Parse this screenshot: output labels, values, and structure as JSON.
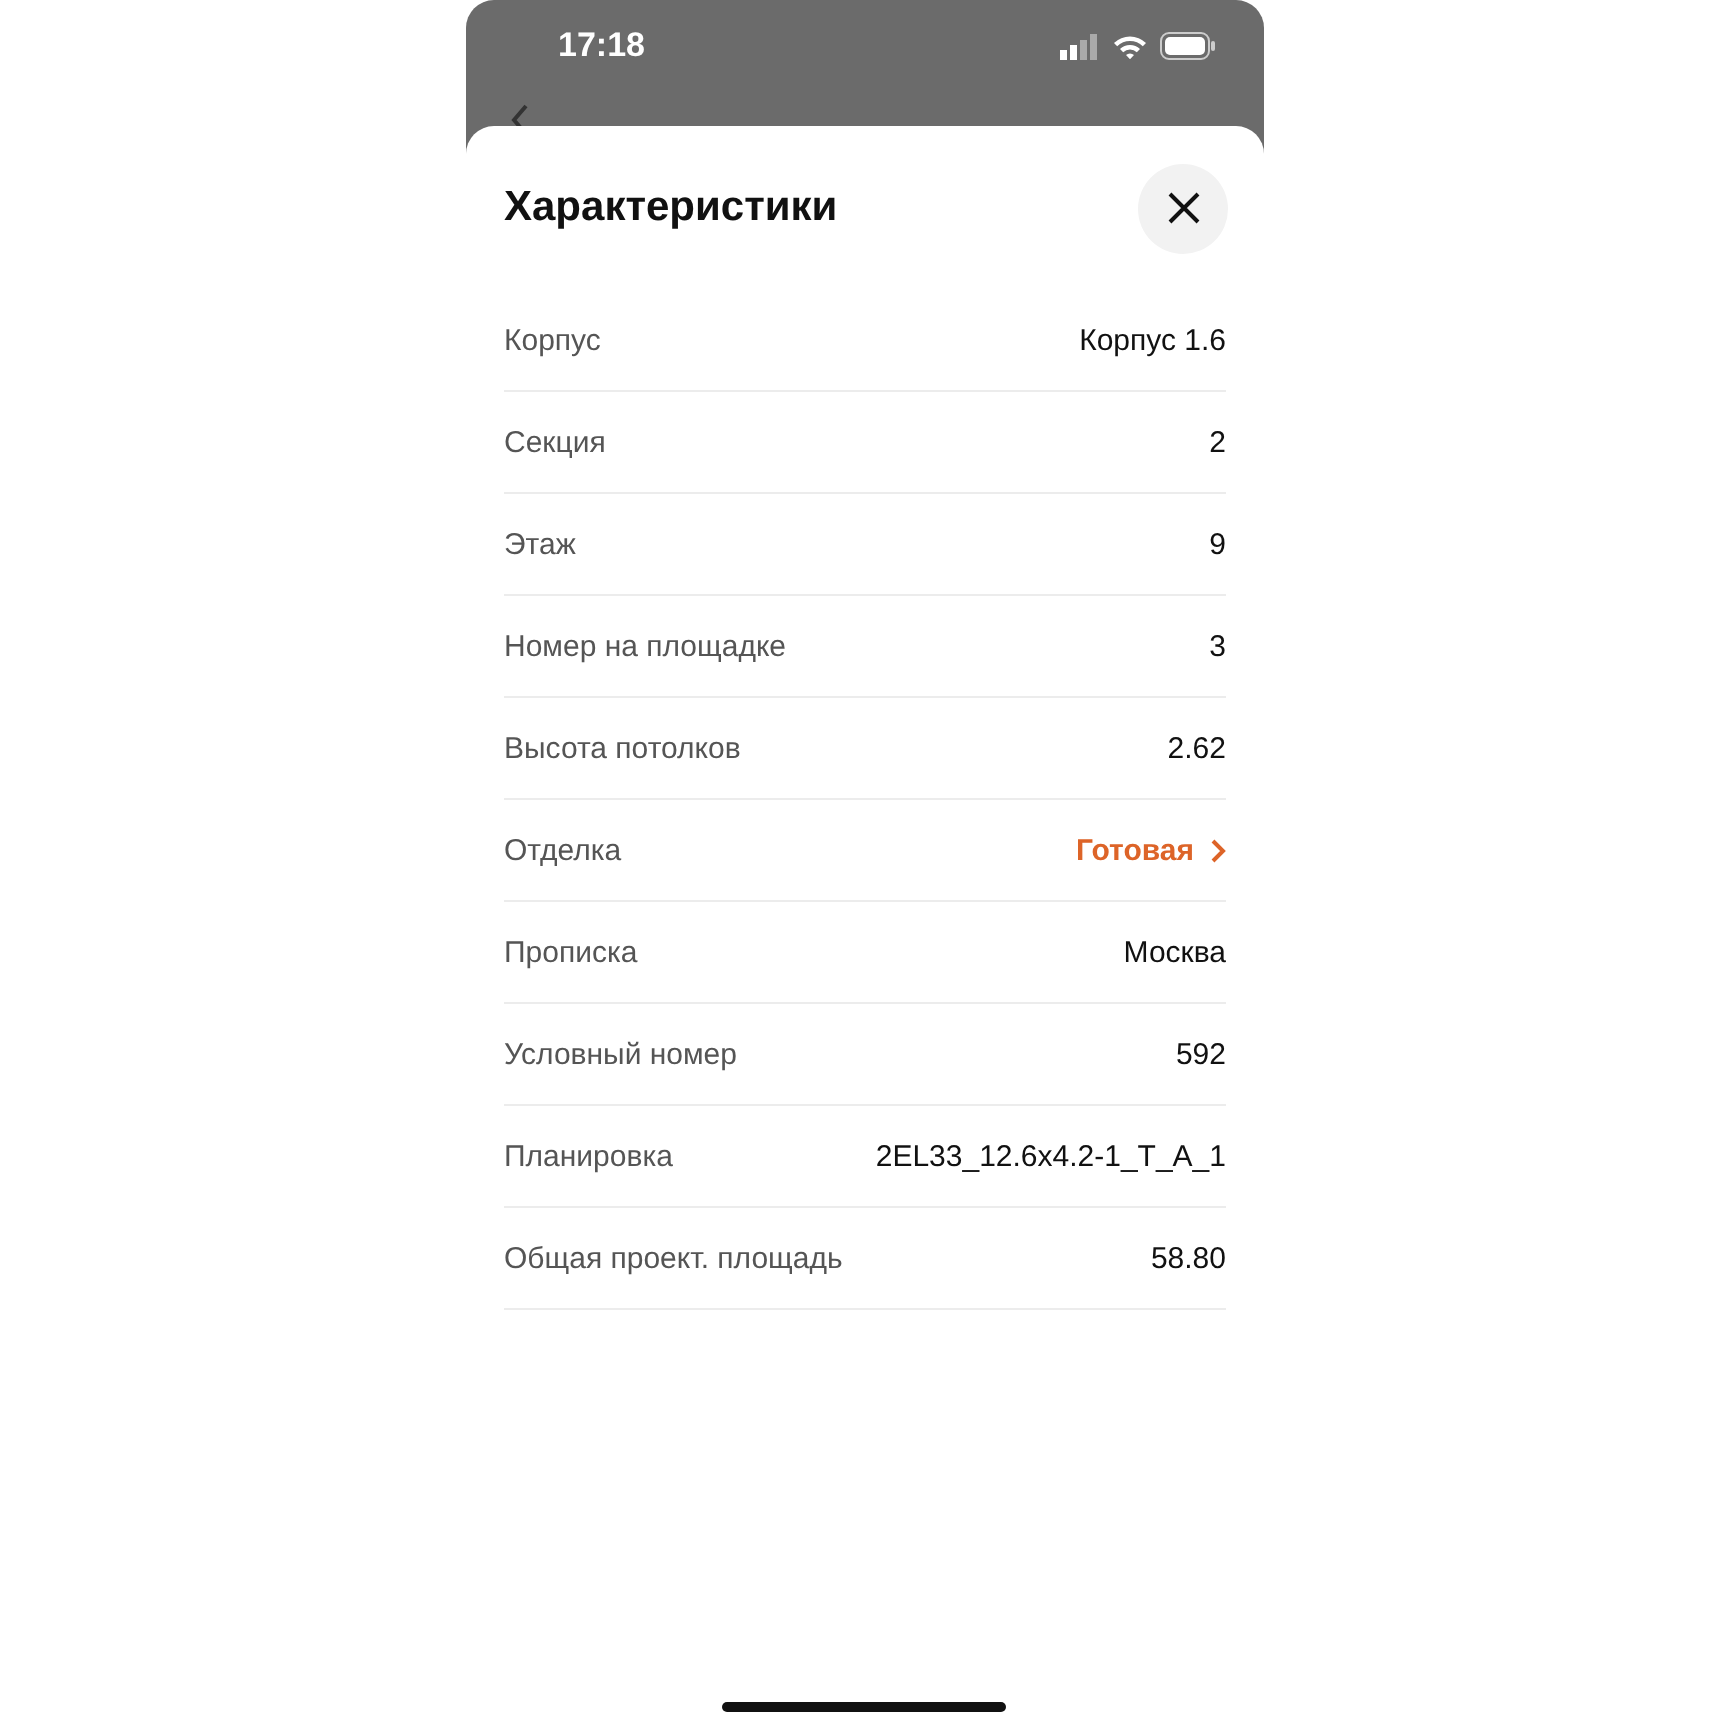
{
  "status_bar": {
    "time": "17:18"
  },
  "sheet": {
    "title": "Характеристики",
    "rows": [
      {
        "label": "Корпус",
        "value": "Корпус 1.6",
        "kind": "plain"
      },
      {
        "label": "Секция",
        "value": "2",
        "kind": "plain"
      },
      {
        "label": "Этаж",
        "value": "9",
        "kind": "plain"
      },
      {
        "label": "Номер на площадке",
        "value": "3",
        "kind": "plain"
      },
      {
        "label": "Высота потолков",
        "value": "2.62",
        "kind": "plain"
      },
      {
        "label": "Отделка",
        "value": "Готовая",
        "kind": "link"
      },
      {
        "label": "Прописка",
        "value": "Москва",
        "kind": "plain"
      },
      {
        "label": "Условный номер",
        "value": "592",
        "kind": "plain"
      },
      {
        "label": "Планировка",
        "value": "2EL33_12.6x4.2-1_T_A_1",
        "kind": "plain"
      },
      {
        "label": "Общая проект. площадь",
        "value": "58.80",
        "kind": "plain"
      }
    ]
  }
}
